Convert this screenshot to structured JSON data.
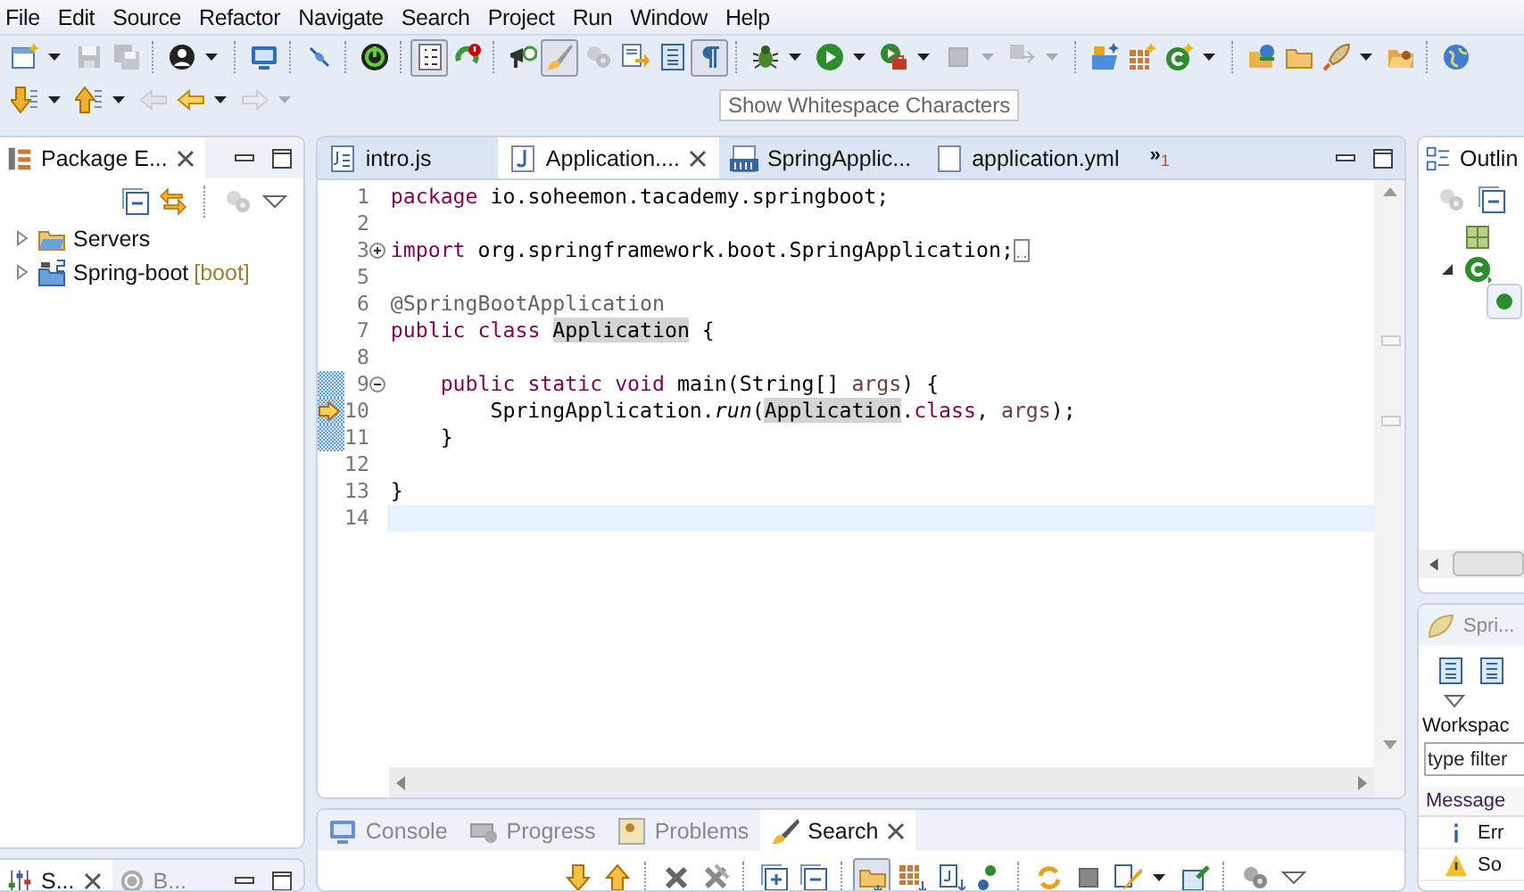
{
  "menu": [
    "File",
    "Edit",
    "Source",
    "Refactor",
    "Navigate",
    "Search",
    "Project",
    "Run",
    "Window",
    "Help"
  ],
  "toolbar_rows": [
    [
      {
        "kind": "new-window",
        "dropdown": true,
        "disabled": false,
        "pressed": false
      },
      {
        "kind": "save",
        "dropdown": false,
        "disabled": true,
        "pressed": false
      },
      {
        "kind": "save-all",
        "dropdown": false,
        "disabled": true,
        "pressed": false
      },
      {
        "kind": "separator"
      },
      {
        "kind": "person",
        "dropdown": true,
        "disabled": false,
        "pressed": false
      },
      {
        "kind": "separator"
      },
      {
        "kind": "monitor",
        "dropdown": false,
        "disabled": false,
        "pressed": false
      },
      {
        "kind": "separator"
      },
      {
        "kind": "slash-pen",
        "dropdown": false,
        "disabled": false,
        "pressed": false
      },
      {
        "kind": "separator"
      },
      {
        "kind": "power",
        "dropdown": false,
        "disabled": false,
        "pressed": false
      },
      {
        "kind": "separator"
      },
      {
        "kind": "line-numbers",
        "dropdown": false,
        "disabled": false,
        "pressed": true
      },
      {
        "kind": "refresh-badge",
        "dropdown": false,
        "disabled": false,
        "pressed": false
      },
      {
        "kind": "separator"
      },
      {
        "kind": "megaphone",
        "dropdown": false,
        "disabled": false,
        "pressed": false
      },
      {
        "kind": "brush",
        "dropdown": false,
        "disabled": false,
        "pressed": true
      },
      {
        "kind": "gears",
        "dropdown": false,
        "disabled": true,
        "pressed": false
      },
      {
        "kind": "doc-arrow",
        "dropdown": false,
        "disabled": false,
        "pressed": false
      },
      {
        "kind": "list-doc",
        "dropdown": false,
        "disabled": false,
        "pressed": false
      },
      {
        "kind": "pilcrow",
        "dropdown": false,
        "disabled": false,
        "pressed": true
      },
      {
        "kind": "separator"
      },
      {
        "kind": "bug",
        "dropdown": true,
        "disabled": false,
        "pressed": false
      },
      {
        "kind": "play",
        "dropdown": true,
        "disabled": false,
        "pressed": false
      },
      {
        "kind": "run-toolbox",
        "dropdown": true,
        "disabled": false,
        "pressed": false
      },
      {
        "kind": "stop",
        "dropdown": true,
        "disabled": true,
        "pressed": false
      },
      {
        "kind": "step",
        "dropdown": true,
        "disabled": true,
        "pressed": false
      },
      {
        "kind": "separator"
      },
      {
        "kind": "new-folder-sparkle",
        "dropdown": false,
        "disabled": false,
        "pressed": false
      },
      {
        "kind": "grid-sparkle",
        "dropdown": false,
        "disabled": false,
        "pressed": false
      },
      {
        "kind": "class-sparkle",
        "dropdown": true,
        "disabled": false,
        "pressed": false
      },
      {
        "kind": "separator"
      },
      {
        "kind": "folder-globe",
        "dropdown": false,
        "disabled": false,
        "pressed": false
      },
      {
        "kind": "folder",
        "dropdown": false,
        "disabled": false,
        "pressed": false
      },
      {
        "kind": "rocket",
        "dropdown": true,
        "disabled": false,
        "pressed": false
      },
      {
        "kind": "folder-open",
        "dropdown": false,
        "disabled": false,
        "pressed": false
      },
      {
        "kind": "separator"
      },
      {
        "kind": "globe",
        "dropdown": false,
        "disabled": false,
        "pressed": false
      }
    ],
    [
      {
        "kind": "arrow-down-list",
        "dropdown": true,
        "disabled": false,
        "pressed": false
      },
      {
        "kind": "arrow-up-list",
        "dropdown": true,
        "disabled": false,
        "pressed": false
      },
      {
        "kind": "back-edit",
        "dropdown": false,
        "disabled": true,
        "pressed": false
      },
      {
        "kind": "back",
        "dropdown": true,
        "disabled": false,
        "pressed": false
      },
      {
        "kind": "forward",
        "dropdown": true,
        "disabled": true,
        "pressed": false
      }
    ]
  ],
  "tooltip": {
    "text": "Show Whitespace Characters"
  },
  "package_explorer": {
    "title": "Package E...",
    "tree": [
      {
        "kind": "folder",
        "label": "Servers",
        "expanded": false
      },
      {
        "kind": "project",
        "label": "Spring-boot",
        "decoration": "[boot]",
        "expanded": false
      }
    ]
  },
  "editor": {
    "tabs": [
      {
        "kind": "js",
        "label": "intro.js",
        "selected": false
      },
      {
        "kind": "java",
        "label": "Application....",
        "selected": true
      },
      {
        "kind": "class",
        "label": "SpringApplic...",
        "selected": false
      },
      {
        "kind": "yml",
        "label": "application.yml",
        "selected": false
      }
    ],
    "overflow": {
      "mark": "»",
      "count": "1"
    },
    "lines": [
      {
        "num": "1",
        "changed": false,
        "current": false,
        "debug": false,
        "folded_tail": false,
        "tokens": [
          {
            "kind": "kw",
            "t": "package"
          },
          {
            "kind": "plain",
            "t": " io.soheemon.tacademy.springboot;"
          }
        ]
      },
      {
        "num": "2",
        "changed": false,
        "current": false,
        "debug": false,
        "folded_tail": false
      },
      {
        "num": "3",
        "fold": {
          "expanded": false
        },
        "changed": false,
        "current": false,
        "debug": false,
        "folded_tail": true,
        "tokens": [
          {
            "kind": "kw",
            "t": "import"
          },
          {
            "kind": "plain",
            "t": " org.springframework.boot.SpringApplication;"
          }
        ]
      },
      {
        "num": "5",
        "changed": false,
        "current": false,
        "debug": false,
        "folded_tail": false
      },
      {
        "num": "6",
        "changed": false,
        "current": false,
        "debug": false,
        "folded_tail": false,
        "tokens": [
          {
            "kind": "ann",
            "t": "@SpringBootApplication"
          }
        ]
      },
      {
        "num": "7",
        "changed": false,
        "current": false,
        "debug": false,
        "folded_tail": false,
        "tokens": [
          {
            "kind": "kw",
            "t": "public"
          },
          {
            "kind": "kw",
            "t": " class "
          },
          {
            "kind": "occ",
            "t": "Application"
          },
          {
            "kind": "plain",
            "t": " {"
          }
        ]
      },
      {
        "num": "8",
        "changed": false,
        "current": false,
        "debug": false,
        "folded_tail": false
      },
      {
        "num": "9",
        "fold": {
          "expanded": true
        },
        "changed": true,
        "current": false,
        "debug": false,
        "folded_tail": false,
        "tokens": [
          {
            "kind": "kw",
            "t": "    public"
          },
          {
            "kind": "kw",
            "t": " static"
          },
          {
            "kind": "kw",
            "t": " void"
          },
          {
            "kind": "plain",
            "t": " main(String[] "
          },
          {
            "kind": "var",
            "t": "args"
          },
          {
            "kind": "plain",
            "t": ") {"
          }
        ]
      },
      {
        "num": "10",
        "changed": true,
        "current": false,
        "debug": true,
        "folded_tail": false,
        "tokens": [
          {
            "kind": "plain",
            "t": "        SpringApplication."
          },
          {
            "kind": "static",
            "t": "run"
          },
          {
            "kind": "plain",
            "t": "("
          },
          {
            "kind": "occ",
            "t": "Application"
          },
          {
            "kind": "plain",
            "t": "."
          },
          {
            "kind": "kw",
            "t": "class"
          },
          {
            "kind": "plain",
            "t": ", "
          },
          {
            "kind": "var",
            "t": "args"
          },
          {
            "kind": "plain",
            "t": ");"
          }
        ]
      },
      {
        "num": "11",
        "changed": true,
        "current": false,
        "debug": false,
        "folded_tail": false,
        "tokens": [
          {
            "kind": "plain",
            "t": "    }"
          }
        ]
      },
      {
        "num": "12",
        "changed": false,
        "current": false,
        "debug": false,
        "folded_tail": false
      },
      {
        "num": "13",
        "changed": false,
        "current": false,
        "debug": false,
        "folded_tail": false,
        "tokens": [
          {
            "kind": "plain",
            "t": "}"
          }
        ]
      },
      {
        "num": "14",
        "changed": false,
        "current": true,
        "debug": false,
        "folded_tail": false
      }
    ]
  },
  "outline": {
    "title": "Outlin",
    "tree": [
      {
        "kind": "imports",
        "selected": false
      },
      {
        "kind": "class",
        "expanded": true,
        "selected": false,
        "children": [
          {
            "kind": "method",
            "selected": true
          }
        ]
      }
    ]
  },
  "spring_panel": {
    "title": "Spri...",
    "section": "Workspac",
    "filter": {
      "placeholder": "type filter"
    },
    "column": "Message",
    "rows": [
      {
        "kind": "info",
        "text": "Err"
      },
      {
        "kind": "warning",
        "text": "So"
      }
    ]
  },
  "bottom_panel": {
    "tabs": [
      {
        "kind": "console",
        "label": "Console",
        "selected": false
      },
      {
        "kind": "progress",
        "label": "Progress",
        "selected": false
      },
      {
        "kind": "problems",
        "label": "Problems",
        "selected": false
      },
      {
        "kind": "search",
        "label": "Search",
        "selected": true
      }
    ],
    "toolbar": [
      {
        "kind": "arrow-down",
        "dropdown": false,
        "disabled": false,
        "pressed": false
      },
      {
        "kind": "arrow-up",
        "dropdown": false,
        "disabled": false,
        "pressed": false
      },
      {
        "kind": "separator"
      },
      {
        "kind": "remove",
        "dropdown": false,
        "disabled": false,
        "pressed": false
      },
      {
        "kind": "remove-all",
        "dropdown": false,
        "disabled": false,
        "pressed": false
      },
      {
        "kind": "separator"
      },
      {
        "kind": "expand-all",
        "dropdown": false,
        "disabled": false,
        "pressed": false
      },
      {
        "kind": "collapse-all",
        "dropdown": false,
        "disabled": false,
        "pressed": false
      },
      {
        "kind": "separator"
      },
      {
        "kind": "folder-down",
        "dropdown": false,
        "disabled": false,
        "pressed": true
      },
      {
        "kind": "grid-down",
        "dropdown": false,
        "disabled": false,
        "pressed": false
      },
      {
        "kind": "doc-down",
        "dropdown": false,
        "disabled": false,
        "pressed": false
      },
      {
        "kind": "nodes",
        "dropdown": false,
        "disabled": false,
        "pressed": false
      },
      {
        "kind": "separator"
      },
      {
        "kind": "sync",
        "dropdown": false,
        "disabled": false,
        "pressed": false
      },
      {
        "kind": "stop",
        "dropdown": false,
        "disabled": false,
        "pressed": false
      },
      {
        "kind": "search-history",
        "dropdown": true,
        "disabled": false,
        "pressed": false
      },
      {
        "kind": "pin",
        "dropdown": false,
        "disabled": false,
        "pressed": false
      },
      {
        "kind": "separator"
      },
      {
        "kind": "gears",
        "dropdown": false,
        "disabled": false,
        "pressed": false
      },
      {
        "kind": "view-menu",
        "dropdown": false,
        "disabled": false,
        "pressed": false
      }
    ]
  },
  "side_bottom_panel": {
    "tabs": [
      {
        "kind": "sliders",
        "label": "S...",
        "selected": true
      },
      {
        "kind": "power",
        "label": "B...",
        "selected": false
      }
    ]
  }
}
